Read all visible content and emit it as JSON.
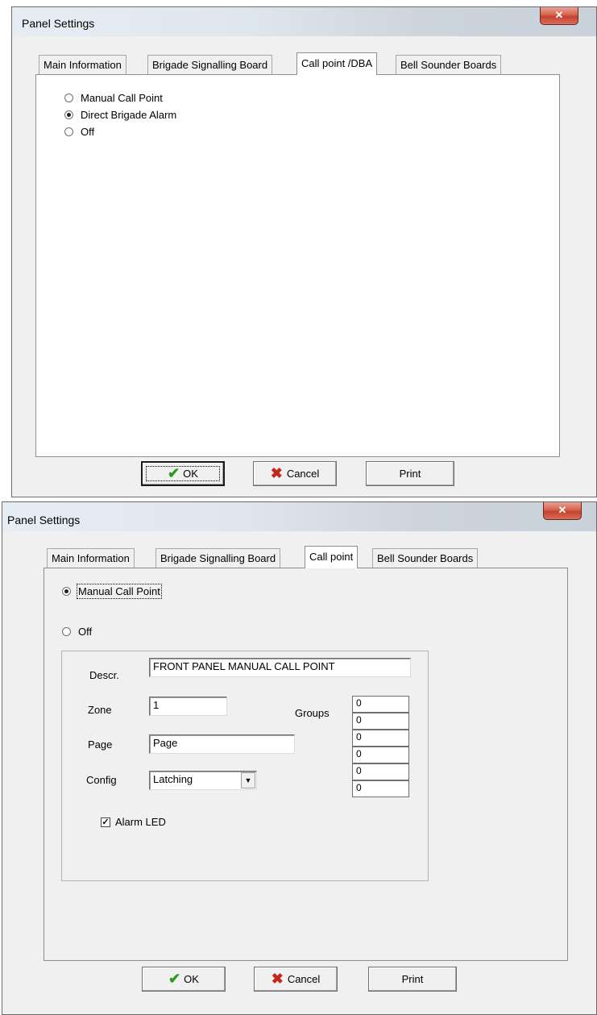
{
  "dialog1": {
    "title": "Panel Settings",
    "close_glyph": "✕",
    "tabs": [
      {
        "label": "Main Information",
        "selected": false
      },
      {
        "label": "Brigade Signalling Board",
        "selected": false
      },
      {
        "label": "Call point /DBA",
        "selected": true
      },
      {
        "label": "Bell Sounder Boards",
        "selected": false
      }
    ],
    "radios": [
      {
        "label": "Manual Call Point",
        "checked": false
      },
      {
        "label": "Direct Brigade Alarm",
        "checked": true
      },
      {
        "label": "Off",
        "checked": false
      }
    ],
    "buttons": {
      "ok": "OK",
      "cancel": "Cancel",
      "print": "Print"
    }
  },
  "dialog2": {
    "title": "Panel Settings",
    "close_glyph": "✕",
    "tabs": [
      {
        "label": "Main Information",
        "selected": false
      },
      {
        "label": "Brigade Signalling Board",
        "selected": false
      },
      {
        "label": "Call point",
        "selected": true
      },
      {
        "label": "Bell Sounder Boards",
        "selected": false
      }
    ],
    "radios": [
      {
        "label": "Manual Call Point",
        "checked": true
      },
      {
        "label": "Off",
        "checked": false
      }
    ],
    "form": {
      "descr_label": "Descr.",
      "descr_value": "FRONT PANEL MANUAL CALL POINT",
      "zone_label": "Zone",
      "zone_value": "1",
      "groups_label": "Groups",
      "groups": [
        "0",
        "0",
        "0",
        "0",
        "0",
        "0"
      ],
      "page_label": "Page",
      "page_value": "Page",
      "config_label": "Config",
      "config_value": "Latching",
      "alarm_led_label": "Alarm LED",
      "alarm_led_checked": true
    },
    "buttons": {
      "ok": "OK",
      "cancel": "Cancel",
      "print": "Print"
    }
  },
  "icons": {
    "ok": "checkmark-icon",
    "cancel": "x-icon",
    "dropdown": "chevron-down-icon"
  },
  "colors": {
    "checkmark": "#2e9a24",
    "cancel_x": "#c1271b",
    "close_button": "#c3422d"
  }
}
